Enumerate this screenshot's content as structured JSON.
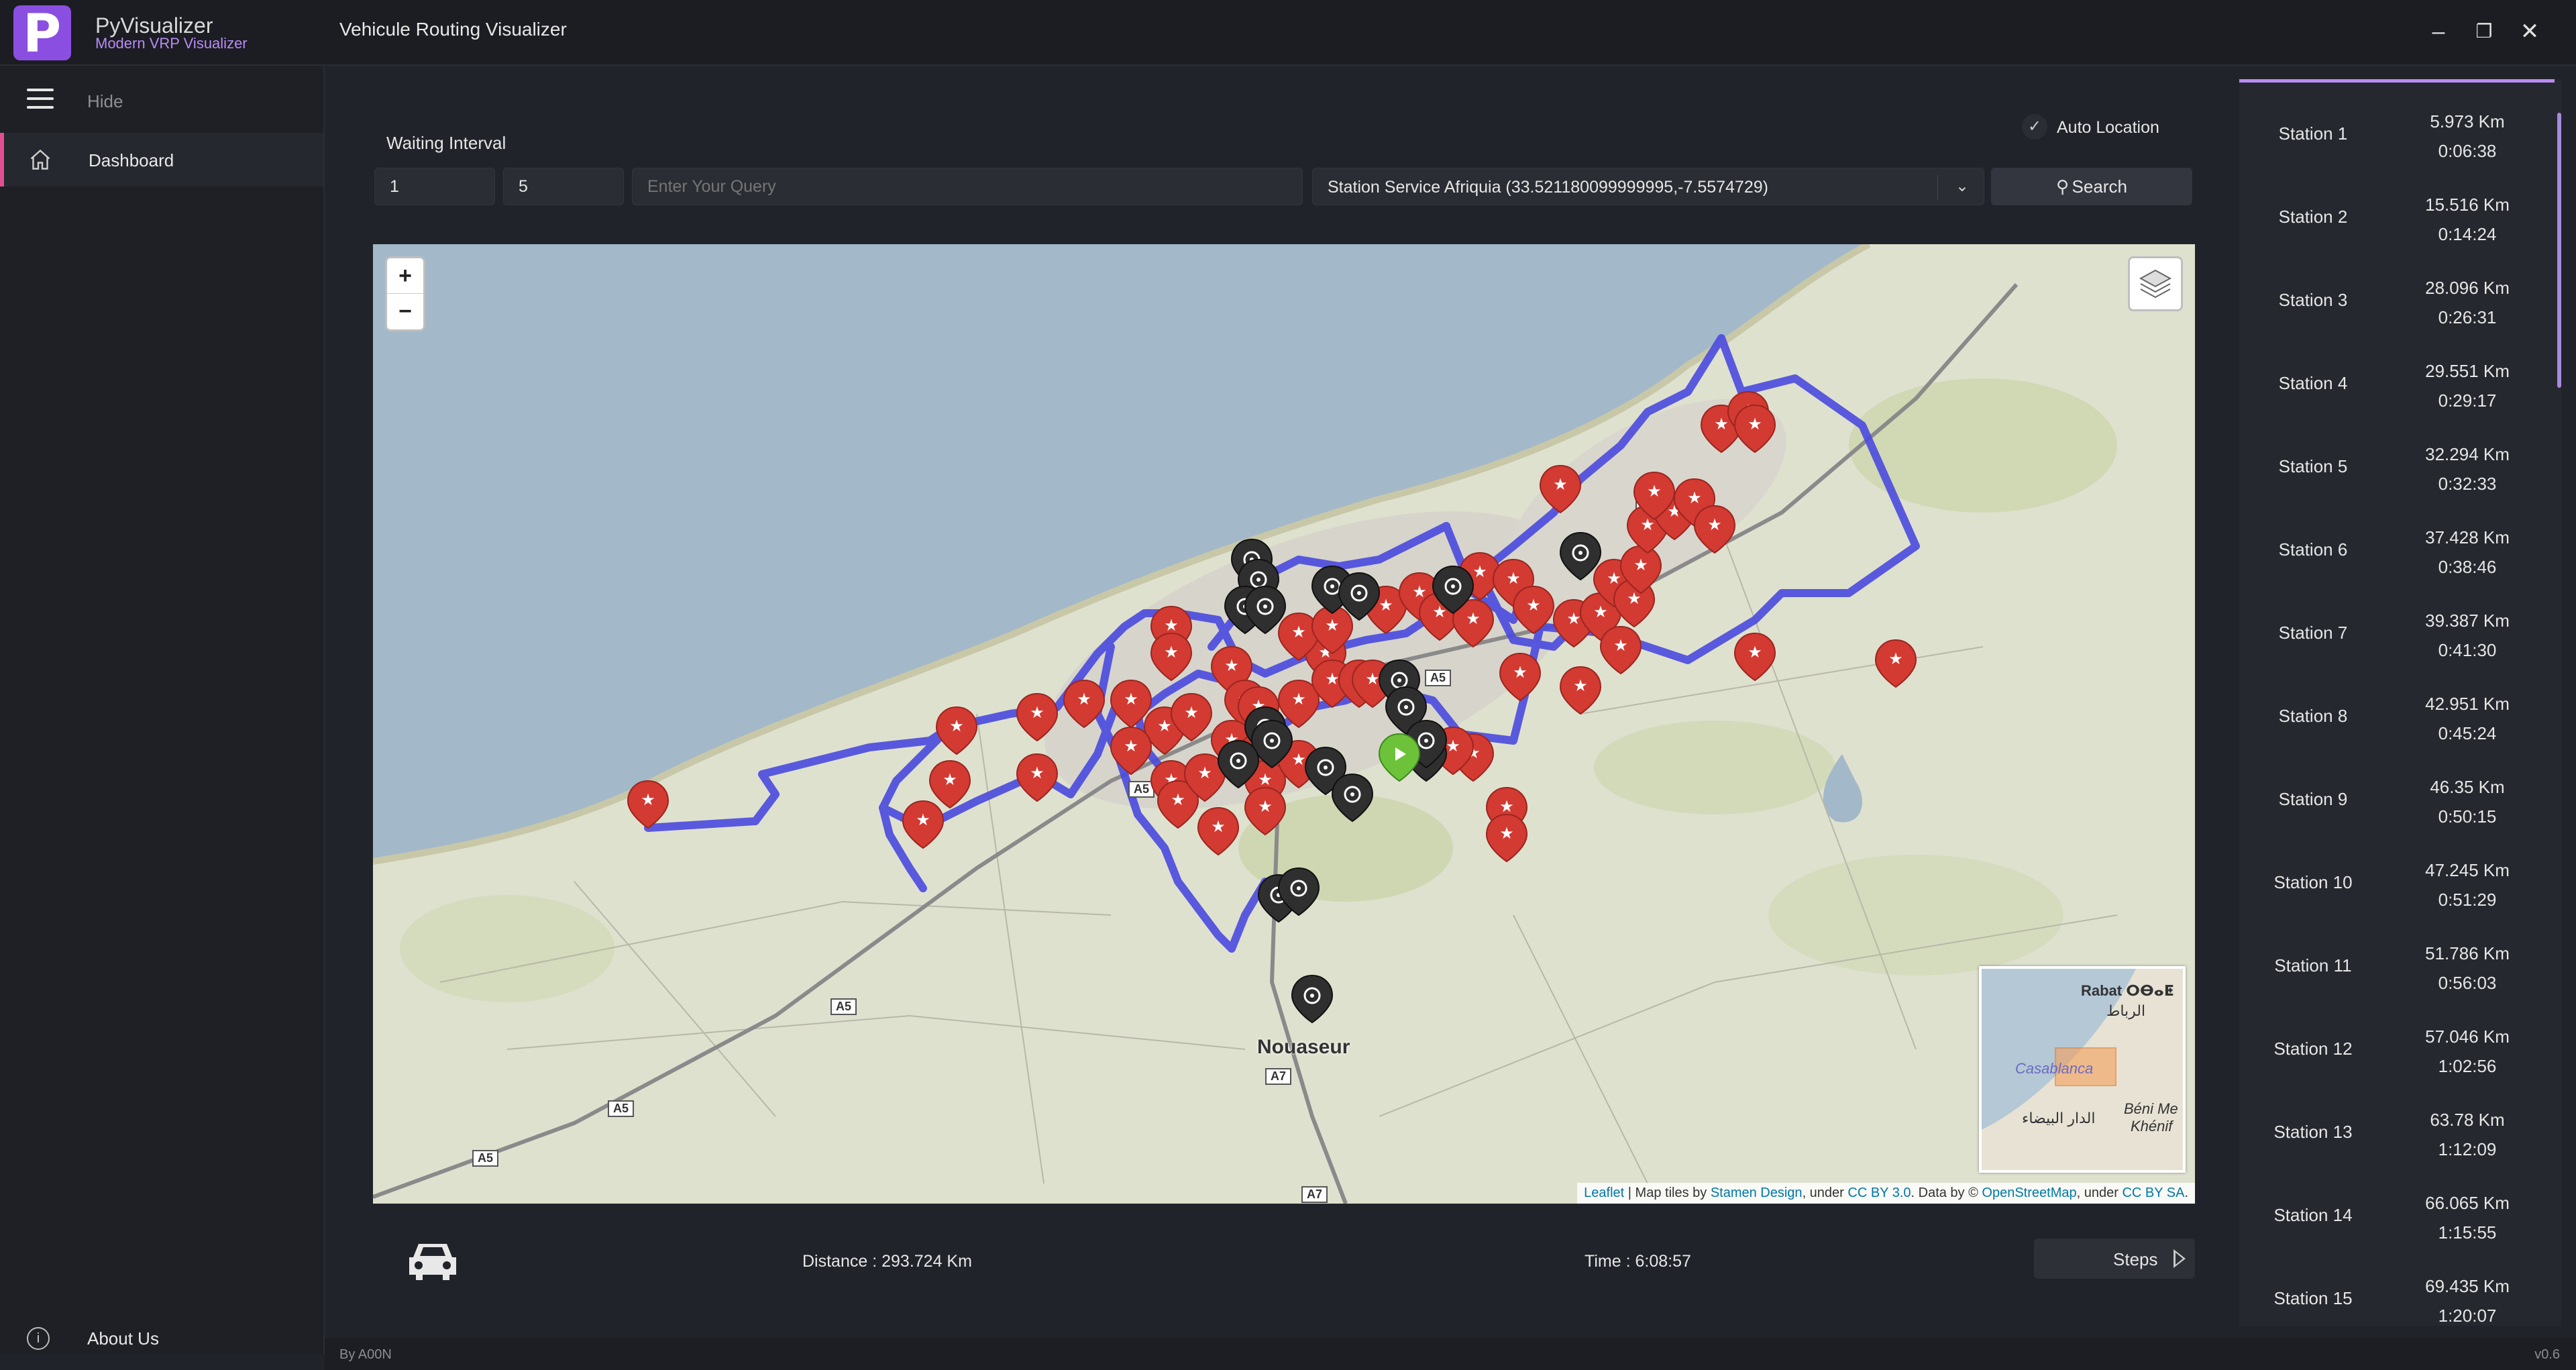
{
  "app": {
    "name": "PyVisualizer",
    "subtitle": "Modern VRP Visualizer",
    "window_title": "Vehicule Routing Visualizer"
  },
  "sidebar": {
    "hide_label": "Hide",
    "items": [
      {
        "label": "Dashboard",
        "icon": "home-icon",
        "active": true
      }
    ],
    "about_label": "About Us"
  },
  "controls": {
    "waiting_label": "Waiting Interval",
    "interval_min": "1",
    "interval_max": "5",
    "query_placeholder": "Enter Your Query",
    "station_select": "Station Service Afriquia (33.521180099999995,-7.5574729)",
    "search_label": "Search",
    "auto_location_label": "Auto Location",
    "auto_location_checked": true
  },
  "map": {
    "zoom_in": "+",
    "zoom_out": "−",
    "attribution": {
      "leaflet": "Leaflet",
      "text1": " | Map tiles by ",
      "stamen": "Stamen Design",
      "text2": ", under ",
      "cc": "CC BY 3.0",
      "text3": ". Data by © ",
      "osm": "OpenStreetMap",
      "text4": ", under ",
      "ccsa": "CC BY SA",
      "text5": "."
    },
    "place_label": "Nouaseur",
    "road_labels": [
      "A5",
      "A5",
      "A5",
      "A5",
      "A5",
      "A5",
      "A5",
      "A7",
      "A7"
    ],
    "minimap": {
      "rabat": "Rabat ⵔⴱⴰⵟ",
      "rabat_ar": "الرباط",
      "casablanca": "Casablanca",
      "casa_ar": "الدار البيضاء",
      "beni": "Béni Me",
      "khenif": "Khénif"
    },
    "colors": {
      "route": "#4a4adf",
      "marker": "#d33a32",
      "poi": "#2f2f2f",
      "start": "#6cc33a",
      "sea": "#a3b9c9",
      "land": "#dfe1cf"
    }
  },
  "summary": {
    "distance": "Distance : 293.724 Km",
    "time": "Time : 6:08:57",
    "steps_label": "Steps"
  },
  "stations": [
    {
      "name": "Station 1",
      "distance": "5.973 Km",
      "time": "0:06:38"
    },
    {
      "name": "Station 2",
      "distance": "15.516 Km",
      "time": "0:14:24"
    },
    {
      "name": "Station 3",
      "distance": "28.096 Km",
      "time": "0:26:31"
    },
    {
      "name": "Station 4",
      "distance": "29.551 Km",
      "time": "0:29:17"
    },
    {
      "name": "Station 5",
      "distance": "32.294 Km",
      "time": "0:32:33"
    },
    {
      "name": "Station 6",
      "distance": "37.428 Km",
      "time": "0:38:46"
    },
    {
      "name": "Station 7",
      "distance": "39.387 Km",
      "time": "0:41:30"
    },
    {
      "name": "Station 8",
      "distance": "42.951 Km",
      "time": "0:45:24"
    },
    {
      "name": "Station 9",
      "distance": "46.35 Km",
      "time": "0:50:15"
    },
    {
      "name": "Station 10",
      "distance": "47.245 Km",
      "time": "0:51:29"
    },
    {
      "name": "Station 11",
      "distance": "51.786 Km",
      "time": "0:56:03"
    },
    {
      "name": "Station 12",
      "distance": "57.046 Km",
      "time": "1:02:56"
    },
    {
      "name": "Station 13",
      "distance": "63.78 Km",
      "time": "1:12:09"
    },
    {
      "name": "Station 14",
      "distance": "66.065 Km",
      "time": "1:15:55"
    },
    {
      "name": "Station 15",
      "distance": "69.435 Km",
      "time": "1:20:07"
    }
  ],
  "footer": {
    "by": "By A00N",
    "version": "v0.6"
  }
}
